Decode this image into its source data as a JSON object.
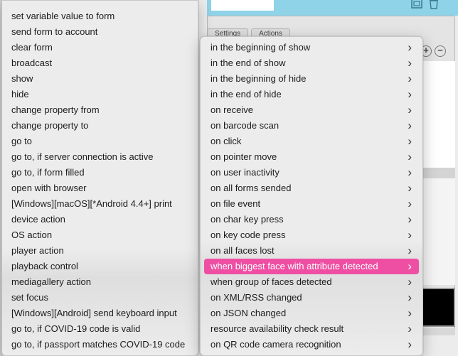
{
  "background": {
    "tabs": [
      "Settings",
      "Actions"
    ],
    "icons": [
      "window-icon",
      "trash-icon"
    ],
    "buttons": [
      "add-icon",
      "remove-icon"
    ]
  },
  "actions_menu": {
    "items": [
      "set variable value to form",
      "send form to account",
      "clear form",
      "broadcast",
      "show",
      "hide",
      "change property from",
      "change property to",
      "go to",
      "go to, if server connection is active",
      "go to, if form filled",
      "open with browser",
      "[Windows][macOS][*Android 4.4+] print",
      "device action",
      "OS action",
      "player action",
      "playback control",
      "mediagallery action",
      "set focus",
      "[Windows][Android] send keyboard input",
      "go to, if COVID-19 code is valid",
      "go to, if passport matches COVID-19 code"
    ]
  },
  "events_menu": {
    "selected_index": 14,
    "selected_color": "#ee4fa3",
    "items": [
      "in the beginning of show",
      "in the end of show",
      "in the beginning of hide",
      "in the end of hide",
      "on receive",
      "on barcode scan",
      "on click",
      "on pointer move",
      "on user inactivity",
      "on all forms sended",
      "on file event",
      "on char key press",
      "on key code press",
      "on all faces lost",
      "when biggest face with attribute detected",
      "when group of faces detected",
      "on XML/RSS changed",
      "on JSON changed",
      "resource availability check result",
      "on QR code camera recognition"
    ]
  }
}
